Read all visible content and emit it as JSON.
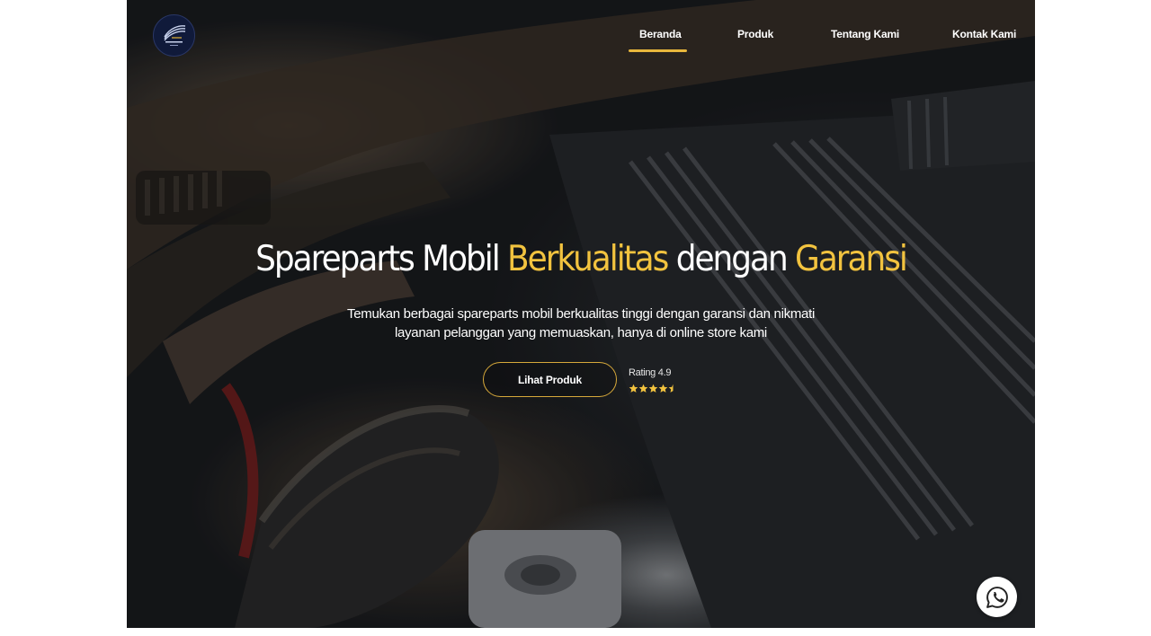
{
  "nav": {
    "items": [
      {
        "label": "Beranda",
        "active": true
      },
      {
        "label": "Produk",
        "active": false
      },
      {
        "label": "Tentang Kami",
        "active": false
      },
      {
        "label": "Kontak Kami",
        "active": false
      }
    ],
    "active_color": "#e8b73c"
  },
  "hero": {
    "headline_part1": "Spareparts Mobil ",
    "headline_highlight1": "Berkualitas",
    "headline_part2": " dengan ",
    "headline_highlight2": "Garansi",
    "highlight_color": "#f2c33f",
    "subtitle_line1": "Temukan berbagai spareparts mobil berkualitas tinggi dengan garansi dan nikmati",
    "subtitle_line2": "layanan pelanggan yang memuaskan, hanya di online store kami",
    "cta_label": "Lihat Produk",
    "rating_label": "Rating 4.9",
    "rating_value": 4.9,
    "rating_max": 5
  },
  "icons": {
    "logo": "brand-logo",
    "whatsapp": "whatsapp-icon",
    "star": "star-icon"
  }
}
